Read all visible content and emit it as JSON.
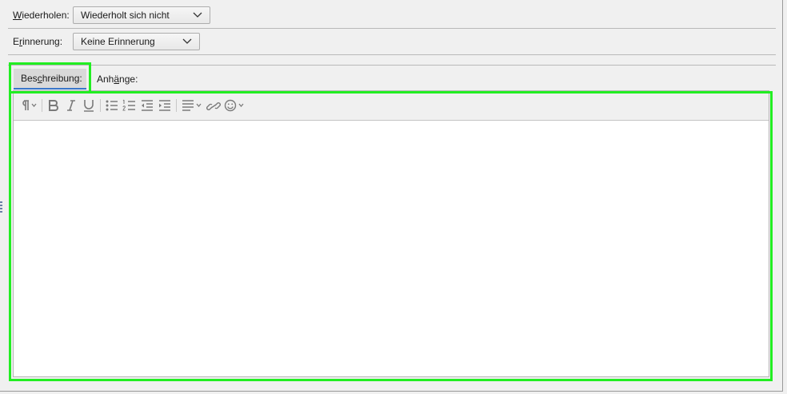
{
  "recurrence": {
    "label_prefix": "",
    "label_underlined": "W",
    "label_rest": "iederholen:",
    "value": "Wiederholt sich nicht"
  },
  "reminder": {
    "label_prefix": "E",
    "label_underlined": "r",
    "label_rest": "innerung:",
    "value": "Keine Erinnerung"
  },
  "tabs": {
    "description": {
      "prefix": "Bes",
      "underlined": "c",
      "rest": "hreibung:"
    },
    "attachments": {
      "prefix": "Anh",
      "underlined": "ä",
      "rest": "nge:"
    }
  },
  "editor_toolbar": {
    "icons": [
      "paragraph-format-icon",
      "bold-icon",
      "italic-icon",
      "underline-icon",
      "bullet-list-icon",
      "numbered-list-icon",
      "decrease-indent-icon",
      "increase-indent-icon",
      "align-icon",
      "link-icon",
      "emoji-icon"
    ]
  },
  "editor": {
    "text": ""
  },
  "colors": {
    "highlight": "#22ee22",
    "active_tab_underline": "#3a77c9",
    "background": "#f0f0f0"
  }
}
